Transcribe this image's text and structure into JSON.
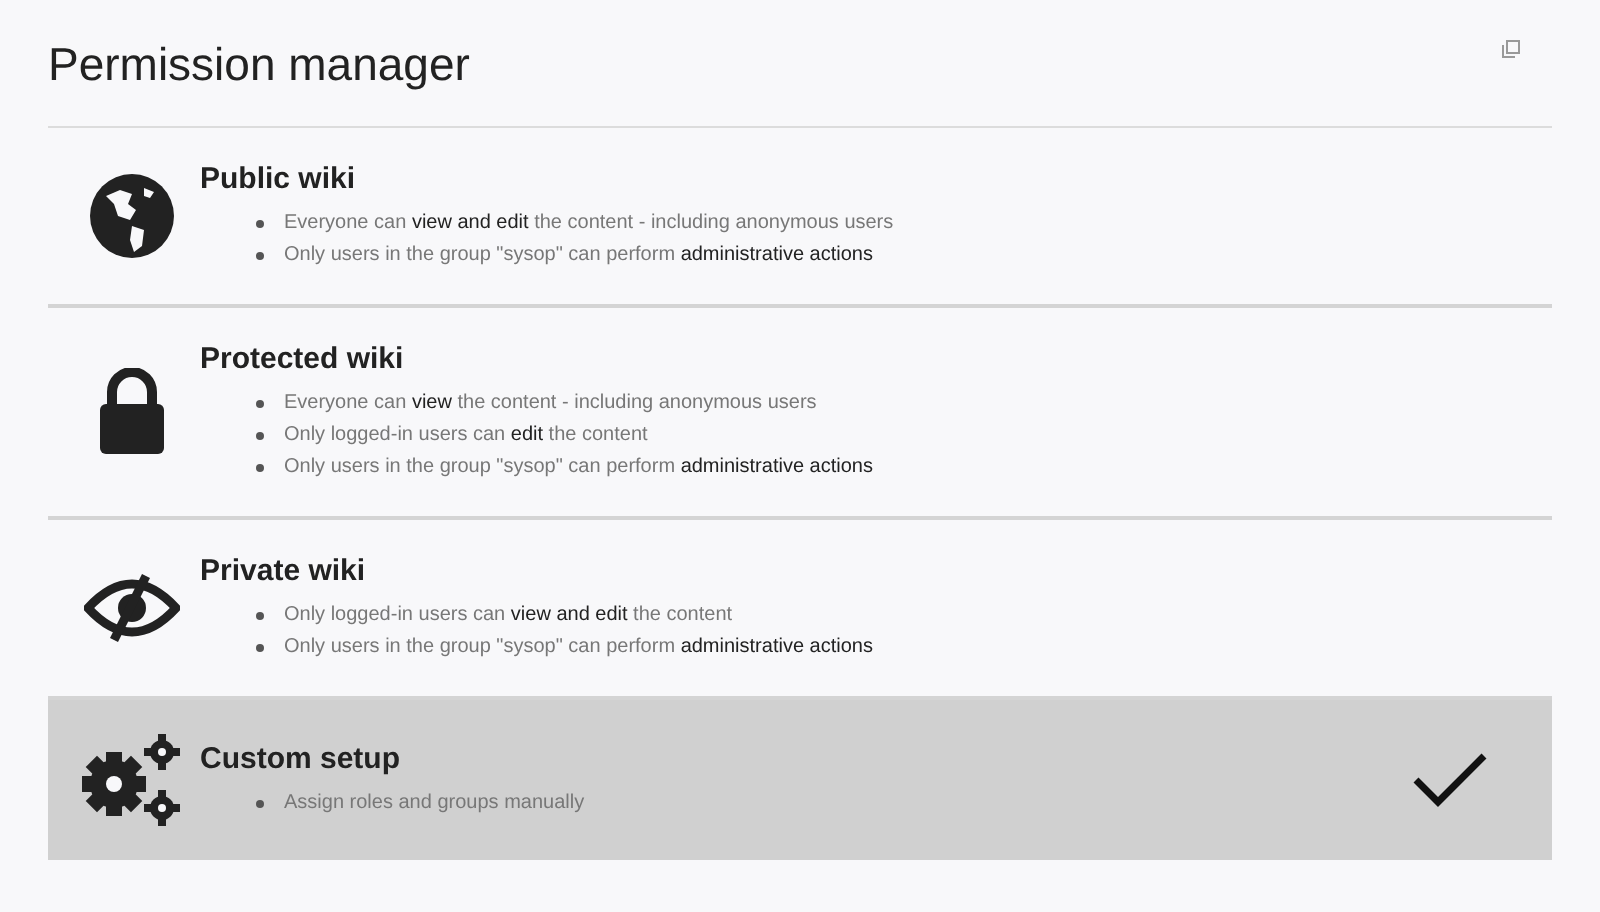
{
  "title": "Permission manager",
  "options": [
    {
      "kind": "public",
      "title": "Public wiki",
      "selected": false,
      "bullets": [
        "Everyone can **view and edit** the content - including anonymous users",
        "Only users in the group \"sysop\" can perform **administrative actions**"
      ]
    },
    {
      "kind": "protected",
      "title": "Protected wiki",
      "selected": false,
      "bullets": [
        "Everyone can **view** the content - including anonymous users",
        "Only logged-in users can **edit** the content",
        "Only users in the group \"sysop\" can perform **administrative actions**"
      ]
    },
    {
      "kind": "private",
      "title": "Private wiki",
      "selected": false,
      "bullets": [
        "Only logged-in users can **view and edit** the content",
        "Only users in the group \"sysop\" can perform **administrative actions**"
      ]
    },
    {
      "kind": "custom",
      "title": "Custom setup",
      "selected": true,
      "bullets": [
        "Assign roles and groups manually"
      ]
    }
  ]
}
